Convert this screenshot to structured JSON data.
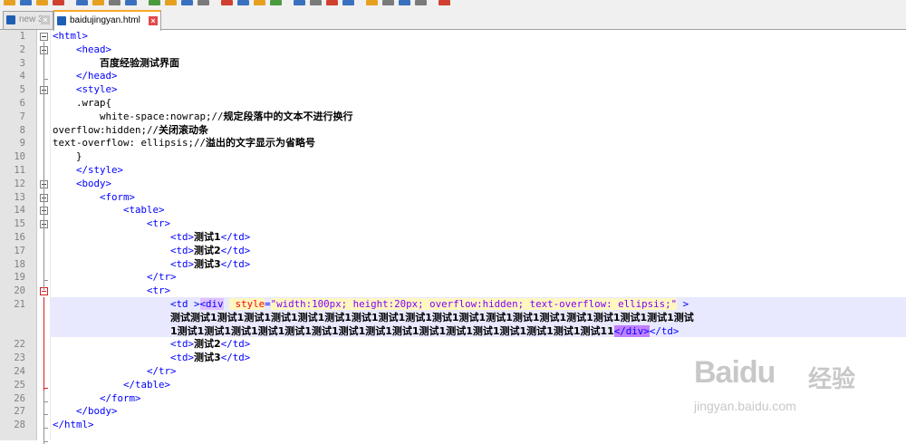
{
  "tabs": [
    {
      "label": "new 3",
      "active": false
    },
    {
      "label": "baidujingyan.html",
      "active": true
    }
  ],
  "lines": [
    {
      "n": "1",
      "segs": [
        [
          "tag",
          "<html>"
        ]
      ]
    },
    {
      "n": "2",
      "segs": [
        [
          "txt",
          "    "
        ],
        [
          "tag",
          "<head>"
        ]
      ]
    },
    {
      "n": "3",
      "segs": [
        [
          "txt",
          "        "
        ],
        [
          "cn",
          "百度经验测试界面"
        ]
      ]
    },
    {
      "n": "4",
      "segs": [
        [
          "txt",
          "    "
        ],
        [
          "tag",
          "</head>"
        ]
      ]
    },
    {
      "n": "5",
      "segs": [
        [
          "txt",
          "    "
        ],
        [
          "tag",
          "<style>"
        ]
      ]
    },
    {
      "n": "6",
      "segs": [
        [
          "txt",
          "    .wrap{"
        ]
      ]
    },
    {
      "n": "7",
      "segs": [
        [
          "txt",
          "        white-space:nowrap;//"
        ],
        [
          "cn",
          "规定段落中的文本不进行换行"
        ]
      ]
    },
    {
      "n": "8",
      "segs": [
        [
          "txt",
          "overflow:hidden;//"
        ],
        [
          "cn",
          "关闭滚动条"
        ]
      ]
    },
    {
      "n": "9",
      "segs": [
        [
          "txt",
          "text-overflow: ellipsis;//"
        ],
        [
          "cn",
          "溢出的文字显示为省略号"
        ]
      ]
    },
    {
      "n": "10",
      "segs": [
        [
          "txt",
          "    }"
        ]
      ]
    },
    {
      "n": "11",
      "segs": [
        [
          "txt",
          "    "
        ],
        [
          "tag",
          "</style>"
        ]
      ]
    },
    {
      "n": "12",
      "segs": [
        [
          "txt",
          "    "
        ],
        [
          "tag",
          "<body>"
        ]
      ]
    },
    {
      "n": "13",
      "segs": [
        [
          "txt",
          "        "
        ],
        [
          "tag",
          "<form>"
        ]
      ]
    },
    {
      "n": "14",
      "segs": [
        [
          "txt",
          "            "
        ],
        [
          "tag",
          "<table>"
        ]
      ]
    },
    {
      "n": "15",
      "segs": [
        [
          "txt",
          "                "
        ],
        [
          "tag",
          "<tr>"
        ]
      ]
    },
    {
      "n": "16",
      "segs": [
        [
          "txt",
          "                    "
        ],
        [
          "tag",
          "<td>"
        ],
        [
          "cn",
          "测试1"
        ],
        [
          "tag",
          "</td>"
        ]
      ]
    },
    {
      "n": "17",
      "segs": [
        [
          "txt",
          "                    "
        ],
        [
          "tag",
          "<td>"
        ],
        [
          "cn",
          "测试2"
        ],
        [
          "tag",
          "</td>"
        ]
      ]
    },
    {
      "n": "18",
      "segs": [
        [
          "txt",
          "                    "
        ],
        [
          "tag",
          "<td>"
        ],
        [
          "cn",
          "测试3"
        ],
        [
          "tag",
          "</td>"
        ]
      ]
    },
    {
      "n": "19",
      "segs": [
        [
          "txt",
          "                "
        ],
        [
          "tag",
          "</tr>"
        ]
      ]
    },
    {
      "n": "20",
      "segs": [
        [
          "txt",
          "                "
        ],
        [
          "tag",
          "<tr>"
        ]
      ]
    },
    {
      "n": "21",
      "segs": [
        [
          "txt",
          "                    "
        ],
        [
          "tag",
          "<td >"
        ],
        [
          "matchopen",
          "<div"
        ],
        [
          "txt",
          " "
        ],
        [
          "attr",
          " style"
        ],
        [
          "tag",
          "="
        ],
        [
          "str",
          "\"width:100px; height:20px; overflow:hidden; text-overflow: ellipsis;\""
        ],
        [
          "txt",
          " "
        ],
        [
          "tag",
          ">"
        ]
      ]
    },
    {
      "n": "",
      "segs": [
        [
          "txt",
          "                    "
        ],
        [
          "cn",
          "测试测试1测试1测试1测试1测试1测试1测试1测试1测试1测试1测试1测试1测试1测试1测试1测试1测试1测试1测试"
        ]
      ]
    },
    {
      "n": "",
      "segs": [
        [
          "txt",
          "                    "
        ],
        [
          "cn",
          "1测试1测试1测试1测试1测试1测试1测试1测试1测试1测试1测试1测试1测试1测试1测试1测试11"
        ],
        [
          "match",
          "</div>"
        ],
        [
          "tag",
          "</td>"
        ]
      ]
    },
    {
      "n": "22",
      "segs": [
        [
          "txt",
          "                    "
        ],
        [
          "tag",
          "<td>"
        ],
        [
          "cn",
          "测试2"
        ],
        [
          "tag",
          "</td>"
        ]
      ]
    },
    {
      "n": "23",
      "segs": [
        [
          "txt",
          "                    "
        ],
        [
          "tag",
          "<td>"
        ],
        [
          "cn",
          "测试3"
        ],
        [
          "tag",
          "</td>"
        ]
      ]
    },
    {
      "n": "24",
      "segs": [
        [
          "txt",
          "                "
        ],
        [
          "tag",
          "</tr>"
        ]
      ]
    },
    {
      "n": "25",
      "segs": [
        [
          "txt",
          "            "
        ],
        [
          "tag",
          "</table>"
        ]
      ]
    },
    {
      "n": "26",
      "segs": [
        [
          "txt",
          "        "
        ],
        [
          "tag",
          "</form>"
        ]
      ]
    },
    {
      "n": "27",
      "segs": [
        [
          "txt",
          "    "
        ],
        [
          "tag",
          "</body>"
        ]
      ]
    },
    {
      "n": "28",
      "segs": [
        [
          "tag",
          "</html>"
        ]
      ]
    }
  ],
  "watermark": {
    "logo": "Baidu",
    "cn": "经验",
    "url": "jingyan.baidu.com"
  },
  "colors": {
    "tag": "#0000ff",
    "attr": "#ff0000",
    "string": "#8000ff",
    "highlight": "#e8e8ff",
    "fold_red": "#d02020"
  }
}
